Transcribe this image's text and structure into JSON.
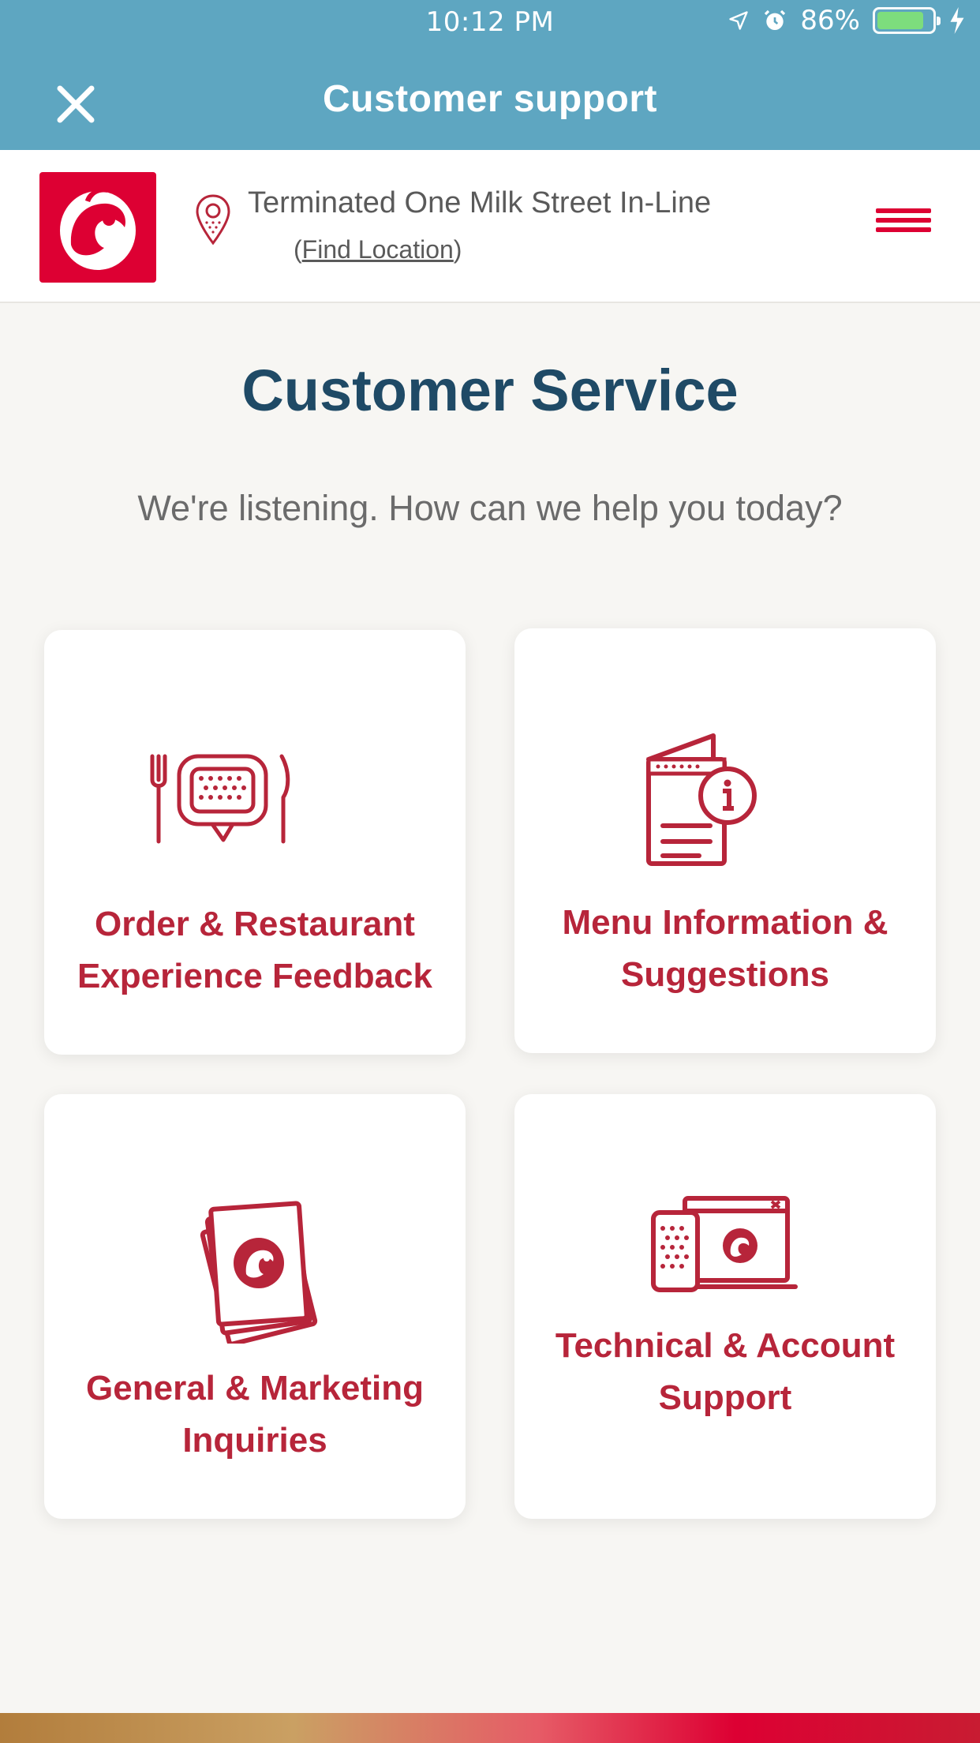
{
  "status_bar": {
    "time": "10:12 PM",
    "battery": "86%",
    "battery_level": 0.86,
    "icons": [
      "location-arrow-icon",
      "alarm-clock-icon",
      "battery-icon",
      "charging-bolt-icon"
    ]
  },
  "header": {
    "title": "Customer support",
    "close_icon": "close-icon"
  },
  "restaurant": {
    "location_name": "Terminated One Milk Street In-Line",
    "find_link_open": "(",
    "find_link_label": "Find Location",
    "find_link_close": ")",
    "logo_icon": "chick-fil-a-logo",
    "pin_icon": "location-pin-icon",
    "menu_icon": "hamburger-menu-icon"
  },
  "main": {
    "title": "Customer Service",
    "subtitle": "We're listening. How can we help you today?",
    "cards": [
      {
        "label": "Order & Restaurant Experience Feedback",
        "icon": "feedback-chat-icon"
      },
      {
        "label": "Menu Information & Suggestions",
        "icon": "menu-info-icon"
      },
      {
        "label": "General & Marketing Inquiries",
        "icon": "marketing-cards-icon"
      },
      {
        "label": "Technical & Account Support",
        "icon": "devices-icon"
      }
    ]
  },
  "colors": {
    "header_bg": "#5ea6c1",
    "brand_red": "#dd0033",
    "label_red": "#b7253a",
    "title_blue": "#1f4a66",
    "page_bg": "#f7f6f3"
  }
}
